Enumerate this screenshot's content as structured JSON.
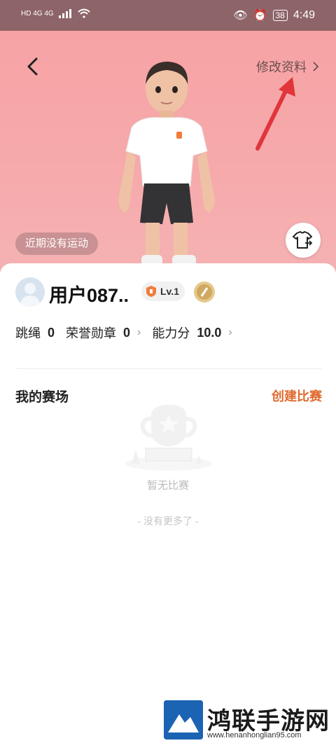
{
  "status_bar": {
    "left": "HD 4G 4G",
    "battery": "38",
    "time": "4:49"
  },
  "header": {
    "edit_label": "修改资料",
    "activity_status": "近期没有运动"
  },
  "profile": {
    "username": "用户087..",
    "level": "Lv.1"
  },
  "stats": [
    {
      "label": "跳绳",
      "value": "0"
    },
    {
      "label": "荣誉勋章",
      "value": "0"
    },
    {
      "label": "能力分",
      "value": "10.0"
    }
  ],
  "arena": {
    "title": "我的赛场",
    "create_label": "创建比赛",
    "empty_text": "暂无比赛",
    "no_more_text": "- 没有更多了 -"
  },
  "watermark": {
    "title": "鸿联手游网",
    "url": "www.henanhonglian95.com"
  },
  "colors": {
    "hero_bg": "#f7a3a4",
    "accent": "#e0692c",
    "annotation_arrow": "#e0353b"
  }
}
